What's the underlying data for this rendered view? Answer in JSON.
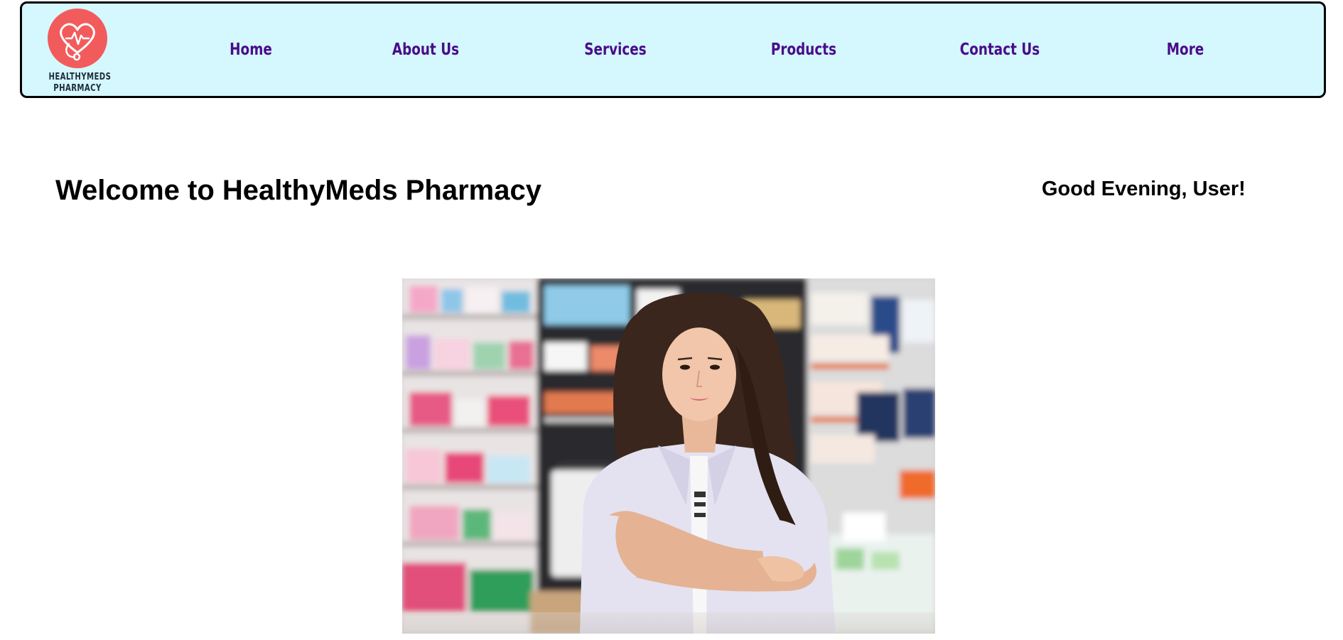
{
  "brand": {
    "logo_line1": "HEALTHYMEDS",
    "logo_line2": "PHARMACY",
    "logo_icon": "heart-stethoscope-icon",
    "logo_color": "#f25b5c"
  },
  "nav": {
    "background": "#d4f8fd",
    "link_color": "#4a0c8a",
    "items": [
      {
        "label": "Home"
      },
      {
        "label": "About Us"
      },
      {
        "label": "Services"
      },
      {
        "label": "Products"
      },
      {
        "label": "Contact Us"
      },
      {
        "label": "More"
      }
    ]
  },
  "main": {
    "title": "Welcome to HealthyMeds Pharmacy",
    "greeting": "Good Evening, User!",
    "hero_image": "pharmacist-photo"
  }
}
